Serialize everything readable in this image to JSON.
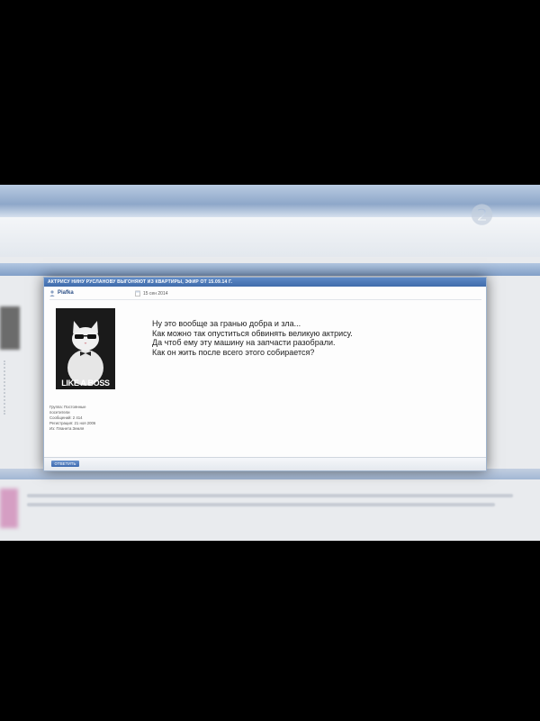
{
  "thread": {
    "title": "АКТРИСУ НИНУ РУСЛАНОВУ ВЫГОНЯЮТ ИЗ КВАРТИРЫ, ЭФИР ОТ 15.09.14 Г."
  },
  "post": {
    "username": "Piafka",
    "date": "15 сен 2014",
    "avatar_caption": "LIKE A BOSS",
    "user_info": [
      "Группа: Постоянные",
      "посетители",
      "Сообщений: 2 414",
      "Регистрация: 21 ноя 2006",
      "Из: Планета Земля"
    ],
    "message_lines": [
      "Ну это вообще за гранью добра и зла...",
      "Как можно так опуститься обвинять великую актрису.",
      "Да чтоб ему эту машину на запчасти разобрали.",
      "Как он жить после всего этого собирается?"
    ]
  },
  "footer": {
    "reply_label": "ОТВЕТИТЬ"
  },
  "colors": {
    "header_blue": "#3f6bab",
    "username_blue": "#2b4f86",
    "page_bg": "#e9ebee"
  },
  "icons": {
    "user": "user-icon",
    "date": "calendar-icon",
    "watermark": "channel-one-logo"
  }
}
